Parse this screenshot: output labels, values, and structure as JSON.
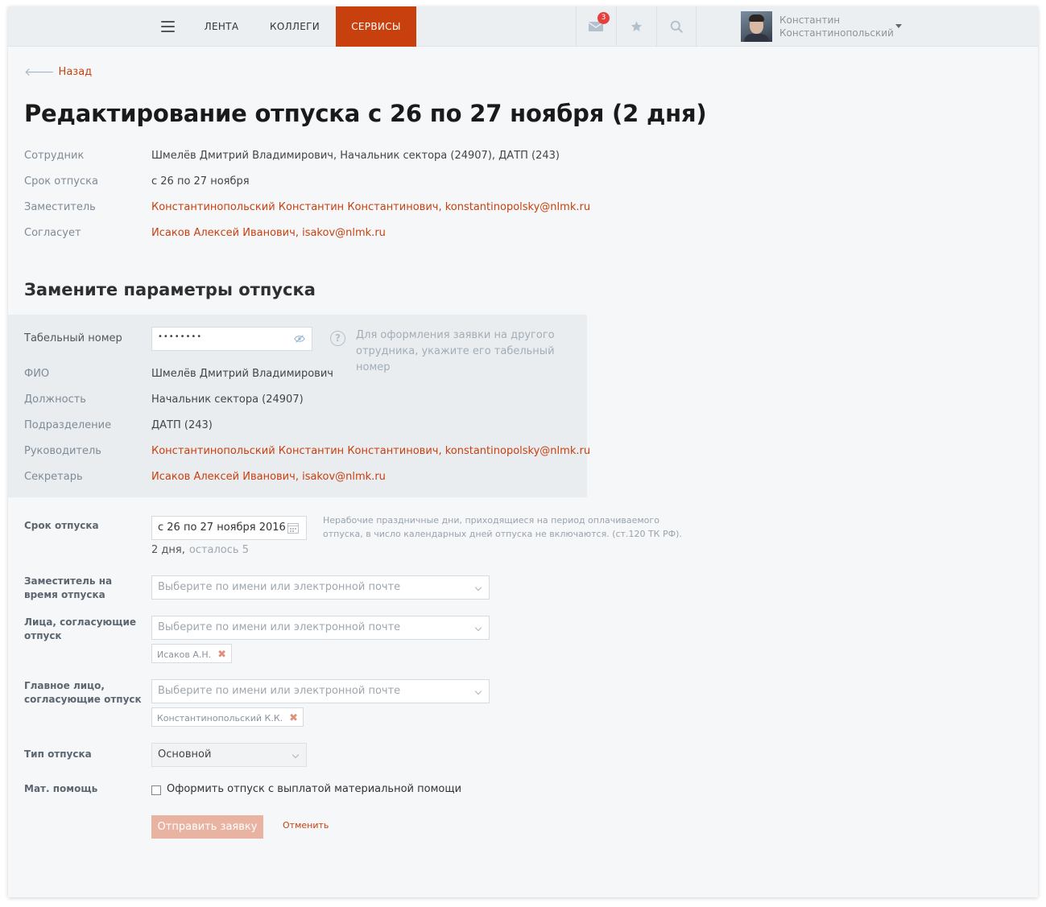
{
  "header": {
    "nav": [
      "ЛЕНТА",
      "КОЛЛЕГИ",
      "СЕРВИСЫ"
    ],
    "mail_badge": "3",
    "user_first": "Константин",
    "user_last": "Константинопольский"
  },
  "back_label": "Назад",
  "title": "Редактирование отпуска с 26 по 27 ноября (2 дня)",
  "summary": [
    {
      "label": "Сотрудник",
      "value": "Шмелёв Дмитрий Владимирович, Начальник сектора (24907), ДАТП (243)"
    },
    {
      "label": "Срок отпуска",
      "value": "с 26 по 27 ноября"
    },
    {
      "label": "Заместитель",
      "value": "Константинопольский Константин Константинович, konstantinopolsky@nlmk.ru"
    },
    {
      "label": "Согласует",
      "value": "Исаков Алексей Иванович, isakov@nlmk.ru"
    }
  ],
  "section_title": "Замените параметры отпуска",
  "employee": {
    "tab_label": "Табельный номер",
    "tab_value": "••••••••",
    "help": "Для оформления заявки на другого отрудника, укажите его табельный номер",
    "rows": [
      {
        "label": "ФИО",
        "value": "Шмелёв Дмитрий Владимирович"
      },
      {
        "label": "Должность",
        "value": "Начальник сектора (24907)"
      },
      {
        "label": "Подразделение",
        "value": "ДАТП (243)"
      },
      {
        "label": "Руководитель",
        "value": "Константинопольский Константин Константинович, konstantinopolsky@nlmk.ru"
      },
      {
        "label": "Секретарь",
        "value": "Исаков Алексей Иванович, isakov@nlmk.ru"
      }
    ]
  },
  "form": {
    "period_label": "Срок отпуска",
    "period_value": "с 26 по 27 ноября 2016",
    "period_note": "Нерабочие праздничные дни, приходящиеся на период оплачиваемого отпуска, в число календарных дней отпуска не включаются. (ст.120 ТК РФ).",
    "days": "2 дня,",
    "remaining": "осталось 5",
    "deputy_label": "Заместитель на время отпуска",
    "approvers_label": "Лица, согласующие отпуск",
    "main_approver_label": "Главное лицо, согласующие отпуск",
    "select_placeholder": "Выберите по имени или электронной почте",
    "approver_tag": "Исаков А.Н.",
    "main_approver_tag": "Константинопольский К.К.",
    "type_label": "Тип отпуска",
    "type_value": "Основной",
    "aid_label": "Мат. помощь",
    "aid_checkbox": "Оформить отпуск с выплатой материальной помощи",
    "submit": "Отправить заявку",
    "cancel": "Отменить"
  }
}
